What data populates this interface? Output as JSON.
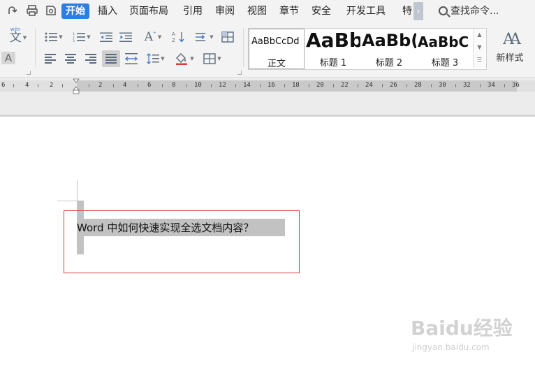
{
  "menubar": {
    "quick_icons": [
      "redo-icon",
      "print-icon",
      "preview-icon"
    ],
    "tabs": [
      {
        "label": "开始",
        "active": true
      },
      {
        "label": "插入"
      },
      {
        "label": "页面布局"
      },
      {
        "label": "引用"
      },
      {
        "label": "审阅"
      },
      {
        "label": "视图"
      },
      {
        "label": "章节"
      },
      {
        "label": "安全"
      },
      {
        "label": "开发工具"
      },
      {
        "label": "特"
      }
    ],
    "more_glyph": "›",
    "search_label": "查找命令..."
  },
  "ribbon": {
    "phonetic_glyph": "文",
    "phonetic_ruby": "wén",
    "char_shade_glyph": "A",
    "font_size_glyph": "A",
    "styles": [
      {
        "sample": "AaBbCcDd",
        "label": "正文"
      },
      {
        "sample": "AaBb",
        "label": "标题 1"
      },
      {
        "sample": "AaBb(",
        "label": "标题 2"
      },
      {
        "sample": "AaBbC",
        "label": "标题 3"
      }
    ],
    "new_style_label": "新样式",
    "new_style_glyph": "AA",
    "accent_color": "#2f7de1"
  },
  "ruler": {
    "left_labels": [
      "6",
      "4",
      "2"
    ],
    "right_labels": [
      "2",
      "4",
      "6",
      "8",
      "10",
      "12",
      "14",
      "16",
      "18",
      "20",
      "22",
      "24",
      "26",
      "28",
      "30",
      "32",
      "34",
      "36"
    ]
  },
  "document": {
    "text": "Word 中如何快速实现全选文档内容？",
    "highlight_color": "#e03a3a"
  },
  "watermark": {
    "brand": "Baidu经验",
    "url": "jingyan.baidu.com"
  }
}
